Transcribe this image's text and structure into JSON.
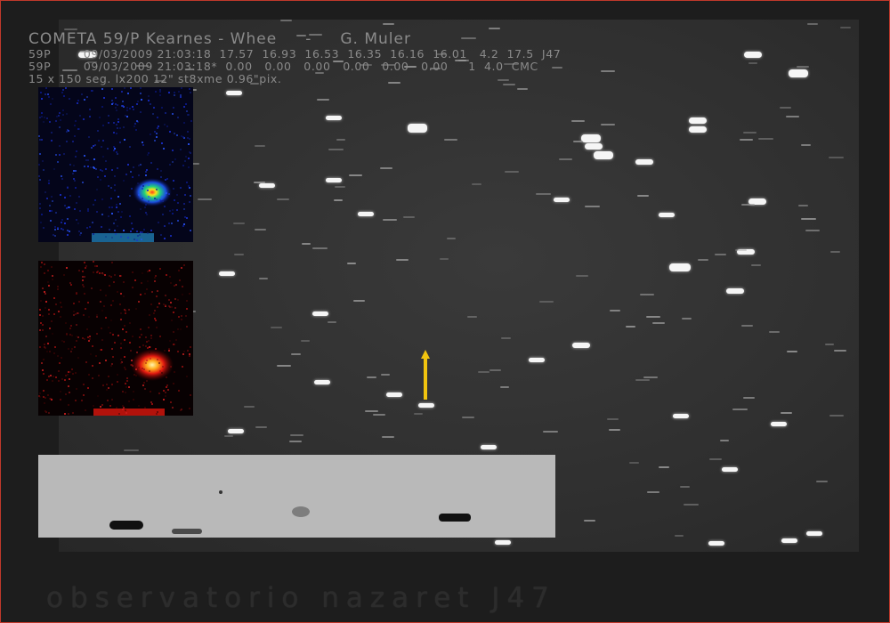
{
  "header": {
    "title": "COMETA 59/P Kearnes - Whee     -     G. Muler",
    "line1": "59P        09/03/2009 21:03:18  17.57  16.93  16.53  16.35  16.16  16.01   4.2  17.5  J47",
    "line2": "59P        09/03/2009 21:03:18*  0.00   0.00   0.00   0.00   0.00   0.00     1  4.0  CMC",
    "line3": "15 x 150 seg. lx200 12\" st8xme 0.96\"pix."
  },
  "footer": {
    "text": "observatorio nazaret J47"
  },
  "colors": {
    "frame_border": "#c0392b",
    "arrow": "#f1c40f"
  }
}
